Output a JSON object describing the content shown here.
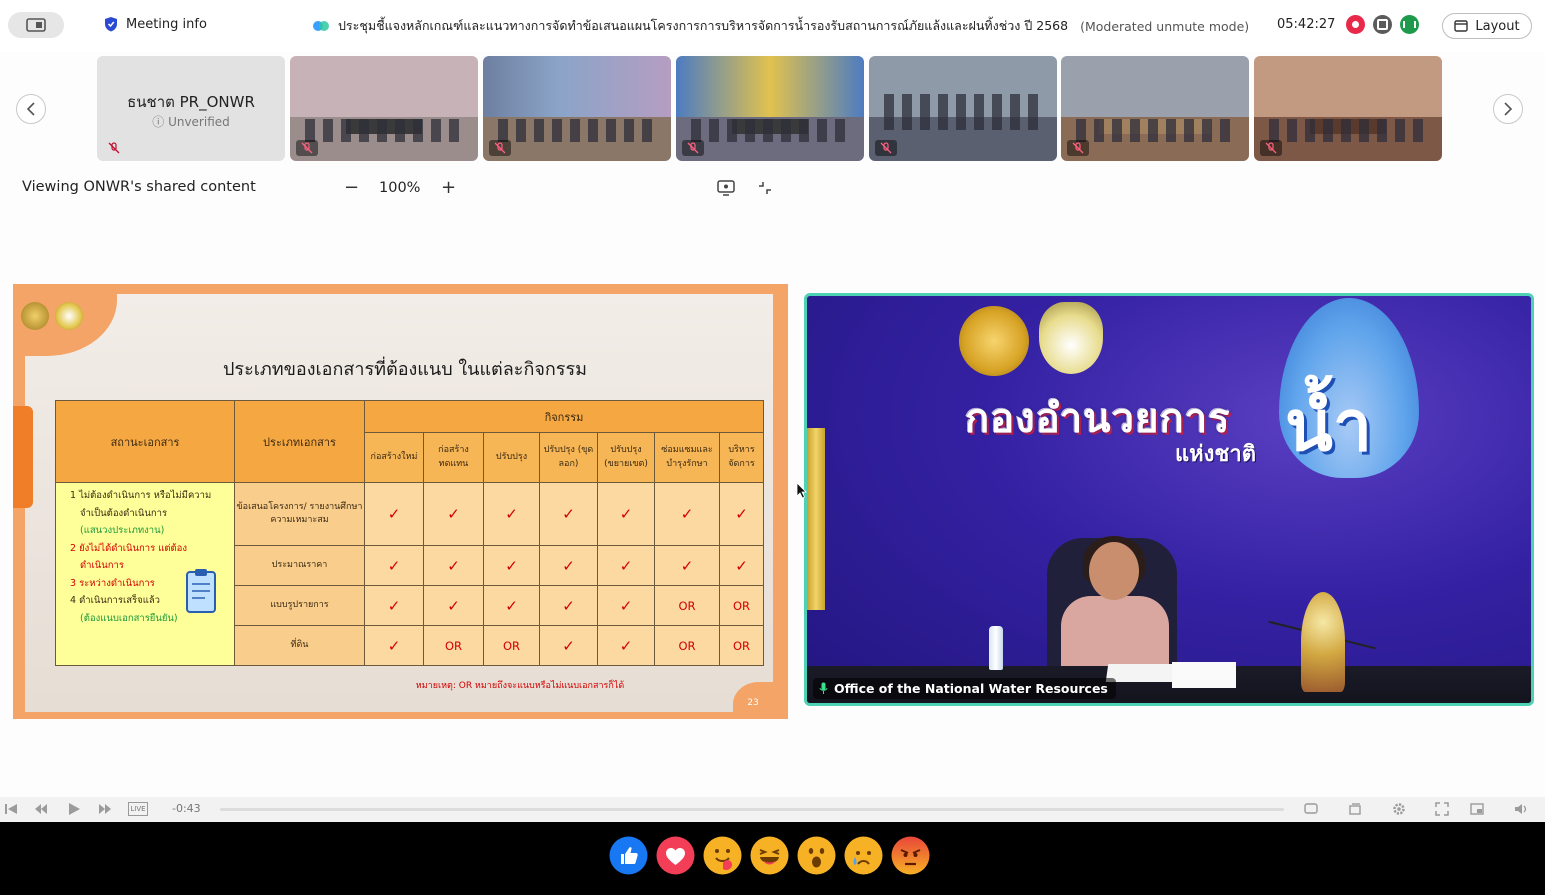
{
  "topbar": {
    "meeting_info_label": "Meeting info",
    "meeting_title": "ประชุมชี้แจงหลักเกณฑ์และแนวทางการจัดทำข้อเสนอแผนโครงการการบริหารจัดการน้ำรองรับสถานการณ์ภัยแล้งและฝนทิ้งช่วง ปี 2568",
    "mode_label": "(Moderated unmute mode)",
    "clock": "05:42:27",
    "layout_label": "Layout"
  },
  "participants": {
    "first_name": "ธนชาต PR_ONWR",
    "first_status": "Unverified"
  },
  "share": {
    "viewing_label": "Viewing ONWR's shared content",
    "zoom_minus": "−",
    "zoom_level": "100%",
    "zoom_plus": "+"
  },
  "slide": {
    "title": "ประเภทของเอกสารที่ต้องแนบ ในแต่ละกิจกรรม",
    "header_status": "สถานะเอกสาร",
    "header_type": "ประเภทเอกสาร",
    "header_activity": "กิจกรรม",
    "activities": [
      "ก่อสร้างใหม่",
      "ก่อสร้าง ทดแทน",
      "ปรับปรุง",
      "ปรับปรุง (ขุดลอก)",
      "ปรับปรุง (ขยายเขต)",
      "ซ่อมแซมและ บำรุงรักษา",
      "บริหาร จัดการ"
    ],
    "status_items": [
      {
        "text": "1 ไม่ต้องดำเนินการ หรือไม่มีความ",
        "cls": ""
      },
      {
        "text": "จำเป็นต้องดำเนินการ",
        "cls": ""
      },
      {
        "text": "(แสนวงประเภทงาน)",
        "cls": "s-green"
      },
      {
        "text": "2 ยังไม่ได้ดำเนินการ แต่ต้อง",
        "cls": "s-red"
      },
      {
        "text": "ดำเนินการ",
        "cls": "s-red"
      },
      {
        "text": "3 ระหว่างดำเนินการ",
        "cls": "s-red"
      },
      {
        "text": "4 ดำเนินการเสร็จแล้ว",
        "cls": ""
      },
      {
        "text": "(ต้องแนบเอกสารยืนยัน)",
        "cls": "s-green"
      }
    ],
    "rows": [
      {
        "type": "ข้อเสนอโครงการ/ รายงานศึกษาความเหมาะสม",
        "cells": [
          "✓",
          "✓",
          "✓",
          "✓",
          "✓",
          "✓",
          "✓"
        ]
      },
      {
        "type": "ประมาณราคา",
        "cells": [
          "✓",
          "✓",
          "✓",
          "✓",
          "✓",
          "✓",
          "✓"
        ]
      },
      {
        "type": "แบบรูปรายการ",
        "cells": [
          "✓",
          "✓",
          "✓",
          "✓",
          "✓",
          "OR",
          "OR"
        ]
      },
      {
        "type": "ที่ดิน",
        "cells": [
          "✓",
          "OR",
          "OR",
          "✓",
          "✓",
          "OR",
          "OR"
        ]
      }
    ],
    "note": "หมายเหตุ: OR หมายถึงจะแนบหรือไม่แนบเอกสารก็ได้",
    "page_number": "23"
  },
  "video": {
    "title_text": "กองอำนวยการ",
    "subtitle_text": "แห่งชาติ",
    "water_text": "น้ำ",
    "speaker_label": "Office of the National Water Resources"
  },
  "player": {
    "live_label": "LIVE",
    "time_offset": "-0:43"
  },
  "colors": {
    "accent_teal": "#4fd1b5",
    "slide_orange": "#f3a466",
    "record_red": "#e8294a"
  },
  "icons": [
    "sidebar-toggle-icon",
    "shield-icon",
    "webex-icon",
    "record-icon",
    "lock-icon",
    "network-icon",
    "layout-icon",
    "chevron-left-icon",
    "chevron-right-icon",
    "mic-muted-icon",
    "share-screen-icon",
    "exit-fullscreen-icon",
    "mic-icon"
  ]
}
